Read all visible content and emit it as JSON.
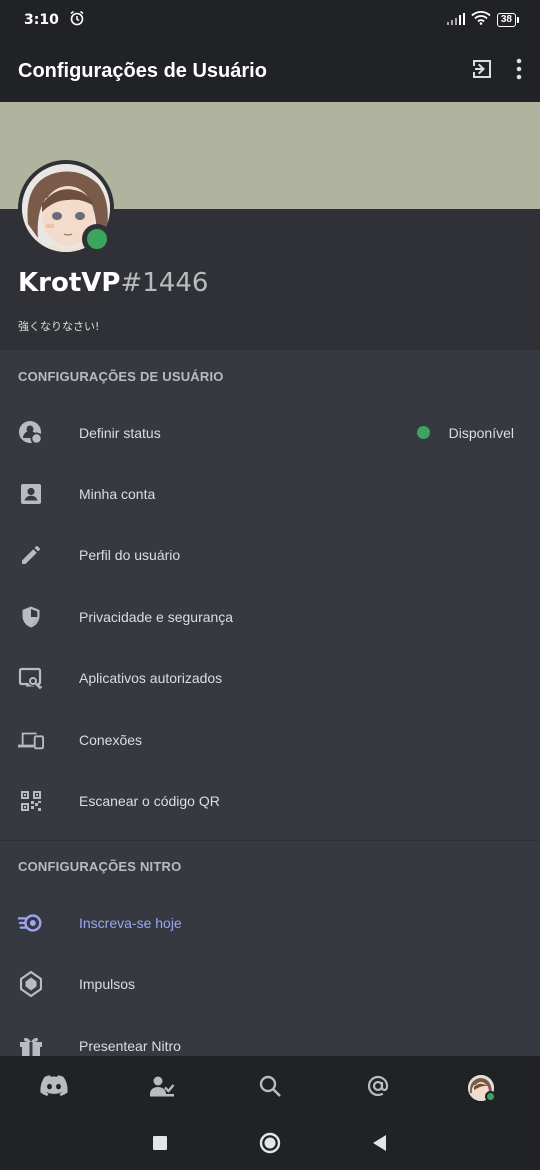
{
  "statusbar": {
    "time": "3:10",
    "battery": "38"
  },
  "appbar": {
    "title": "Configurações de Usuário"
  },
  "profile": {
    "username": "KrotVP",
    "discriminator": "#1446",
    "bio": "強くなりなさい!"
  },
  "user_settings": {
    "header": "CONFIGURAÇÕES DE USUÁRIO",
    "items": [
      {
        "label": "Definir status",
        "icon": "status-icon",
        "status": "Disponível"
      },
      {
        "label": "Minha conta",
        "icon": "account-icon"
      },
      {
        "label": "Perfil do usuário",
        "icon": "pencil-icon"
      },
      {
        "label": "Privacidade e segurança",
        "icon": "shield-icon"
      },
      {
        "label": "Aplicativos autorizados",
        "icon": "authorized-apps-icon"
      },
      {
        "label": "Conexões",
        "icon": "devices-icon"
      },
      {
        "label": "Escanear o código QR",
        "icon": "qr-code-icon"
      }
    ]
  },
  "nitro_settings": {
    "header": "CONFIGURAÇÕES NITRO",
    "items": [
      {
        "label": "Inscreva-se hoje",
        "icon": "nitro-icon"
      },
      {
        "label": "Impulsos",
        "icon": "boost-icon"
      },
      {
        "label": "Presentear Nitro",
        "icon": "gift-icon"
      }
    ]
  },
  "colors": {
    "accent": "#9ba4f5",
    "online": "#3ba55d",
    "banner": "#b0b39d"
  }
}
